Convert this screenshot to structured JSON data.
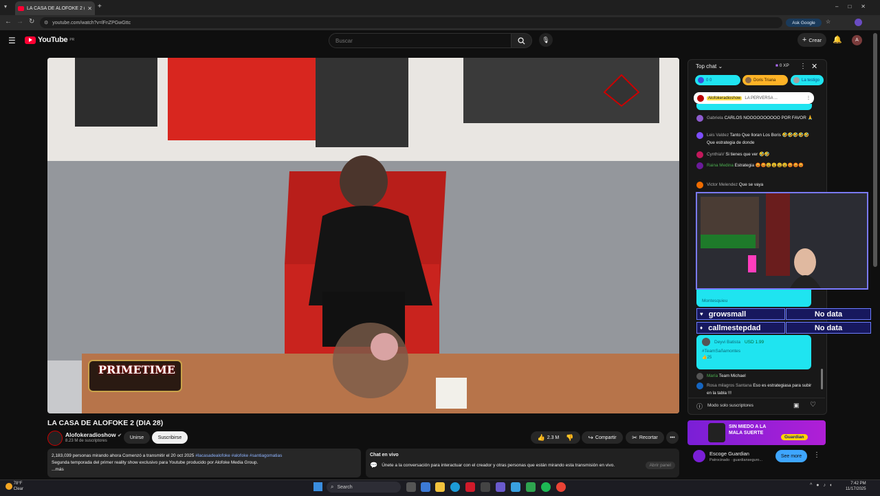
{
  "browser": {
    "tab_title": "LA CASA DE ALOFOKE 2 (D",
    "url": "youtube.com/watch?v=lFnZPGwGttc",
    "ask_google": "Ask Google"
  },
  "youtube": {
    "logo_text": "YouTube",
    "logo_region": "PR",
    "search_placeholder": "Buscar",
    "create_label": "Crear",
    "avatar_letter": "A"
  },
  "video": {
    "title": "LA CASA DE ALOFOKE 2 (DIA 28)",
    "overlay_logo": "PRIMETIME"
  },
  "channel": {
    "name": "Alofokeradioshow",
    "subscribers": "8.23 M de suscriptores",
    "join_label": "Unirse",
    "subscribe_label": "Suscribirse"
  },
  "actions": {
    "likes": "2.3 M",
    "share_label": "Compartir",
    "clip_label": "Recortar"
  },
  "description": {
    "stats": "2,183,039 personas mirando ahora  Comenzó a transmitir el 20 oct 2025",
    "hashtags": "#lacasadealofoke #alofoke #santiagomatias",
    "text": "Segunda temporada del primer reality show exclusivo para Youtube producido por Alofoke Media Group.",
    "more": "...más"
  },
  "livechat_panel": {
    "title": "Chat en vivo",
    "text": "Únete a la conversación para interactuar con el creador y otras personas que están mirando esta transmisión en vivo.",
    "button": "Abrir panel"
  },
  "chat": {
    "header": "Top chat",
    "xp": "0 XP",
    "chips": [
      {
        "label": "0   0"
      },
      {
        "label": "Doris Triana"
      },
      {
        "label": "La testigo"
      }
    ],
    "pinned": {
      "author": "Alofokeradioshow",
      "text": "LA PERVERSA ..."
    },
    "messages": [
      {
        "author": "Gabriela",
        "text": "CARLOS NOOOOOOOOOO POR FAVOR 🙏",
        "color": "#8e5ccf"
      },
      {
        "author": "Leis Valdez",
        "text": "Tanto Que lloran Los Boris 🤣🤣🤣🤣🤣 Que estrategia de donde",
        "color": "#7c4dff"
      },
      {
        "author": "CynthiaV",
        "text": "Si tienes que ver 🤣🤣",
        "color": "#c2185b"
      },
      {
        "author": "Raina Medina",
        "text": "Estrategia 😡😡😩😩😩😩😡😡😡",
        "color": "#6a1b9a"
      },
      {
        "author": "Victor Melendez",
        "text": "Que se vaya",
        "color": "#ef6c00"
      }
    ],
    "superchat1": {
      "author": "Monte",
      "text": "Montesquieu"
    },
    "overlay_rows": [
      {
        "name": "growsmall",
        "value": "No data"
      },
      {
        "name": "callmestepdad",
        "value": "No data"
      }
    ],
    "superchat2": {
      "author": "Deyvi Batista",
      "amount": "USD 1.99",
      "text": "#TeamSañamontes",
      "likes": "25"
    },
    "messages2": [
      {
        "author": "María",
        "text": "Team Michael",
        "color": "#555"
      },
      {
        "author": "Rosa milagros Santana",
        "text": "Eso es estrategiasa para subir en la tabla !!!",
        "color": "#1565c0"
      }
    ],
    "footer": "Modo solo suscriptores"
  },
  "ad": {
    "banner_text": "SIN MIEDO A LA MALA SUERTE",
    "brand": "Guardian",
    "title": "Escoge Guardian",
    "sponsored": "Patrocinado · guardianseguro...",
    "button": "See more"
  },
  "taskbar": {
    "weather_temp": "78°F",
    "weather_desc": "Clear",
    "search_label": "Search",
    "time": "7:42 PM",
    "date": "11/17/2025"
  }
}
